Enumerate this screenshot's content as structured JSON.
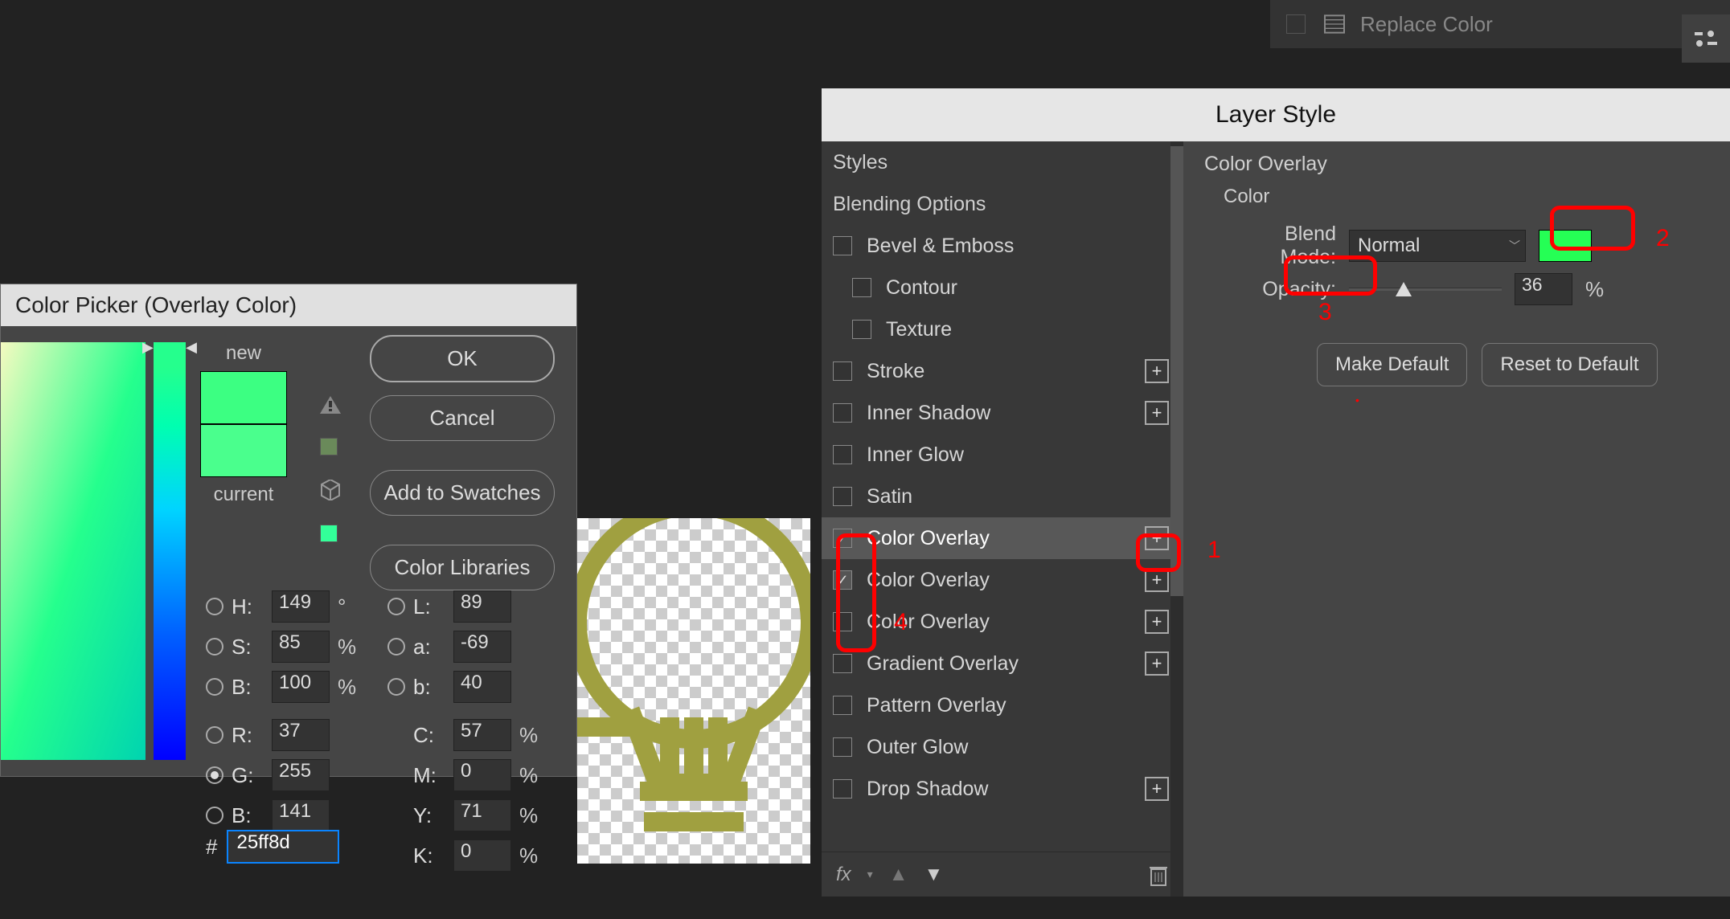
{
  "top_panel": {
    "label": "Replace Color"
  },
  "color_picker": {
    "title": "Color Picker (Overlay Color)",
    "new_label": "new",
    "current_label": "current",
    "buttons": {
      "ok": "OK",
      "cancel": "Cancel",
      "add": "Add to Swatches",
      "libraries": "Color Libraries"
    },
    "hsb": {
      "h_label": "H:",
      "h": "149",
      "h_unit": "°",
      "s_label": "S:",
      "s": "85",
      "s_unit": "%",
      "b_label": "B:",
      "b": "100",
      "b_unit": "%"
    },
    "rgb": {
      "r_label": "R:",
      "r": "37",
      "g_label": "G:",
      "g": "255",
      "bb_label": "B:",
      "bb": "141"
    },
    "lab": {
      "l_label": "L:",
      "l": "89",
      "a_label": "a:",
      "a": "-69",
      "bl_label": "b:",
      "bl": "40"
    },
    "cmyk": {
      "c_label": "C:",
      "c": "57",
      "m_label": "M:",
      "m": "0",
      "y_label": "Y:",
      "y": "71",
      "k_label": "K:",
      "k": "0",
      "unit": "%"
    },
    "hex_label": "#",
    "hex": "25ff8d",
    "swatch_new_color": "#3cff82",
    "swatch_cur_color": "#4aff8d"
  },
  "layer_style": {
    "title": "Layer Style",
    "side": {
      "styles": "Styles",
      "blending": "Blending Options",
      "bevel": "Bevel & Emboss",
      "contour": "Contour",
      "texture": "Texture",
      "stroke": "Stroke",
      "innershadow": "Inner Shadow",
      "innerglow": "Inner Glow",
      "satin": "Satin",
      "coloroverlay1": "Color Overlay",
      "coloroverlay2": "Color Overlay",
      "coloroverlay3": "Color Overlay",
      "gradoverlay": "Gradient Overlay",
      "patoverlay": "Pattern Overlay",
      "outerglow": "Outer Glow",
      "dropshadow": "Drop Shadow",
      "fx": "fx"
    },
    "main": {
      "header": "Color Overlay",
      "sub": "Color",
      "blend_label": "Blend Mode:",
      "blend_value": "Normal",
      "opacity_label": "Opacity:",
      "opacity_value": "36",
      "opacity_unit": "%",
      "make_default": "Make Default",
      "reset_default": "Reset to Default",
      "swatch_color": "#20ff5a"
    }
  },
  "annotations": {
    "n1": "1",
    "n2": "2",
    "n3": "3",
    "n4": "4"
  }
}
